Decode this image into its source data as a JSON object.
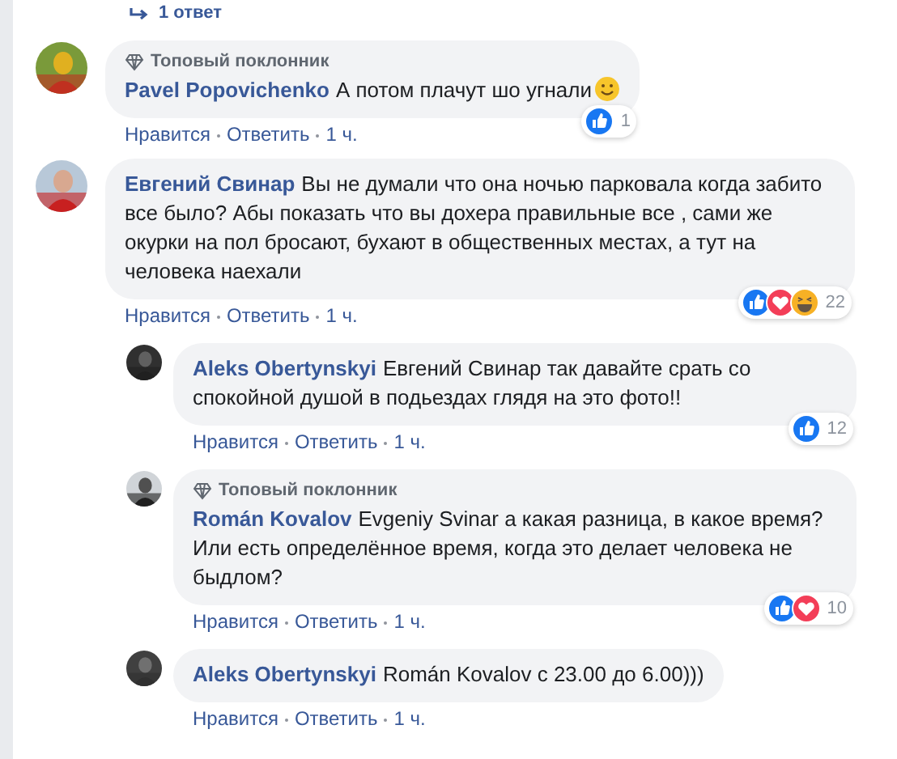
{
  "reply_link": {
    "text": "1 ответ"
  },
  "comments": [
    {
      "badge": "Топовый поклонник",
      "author": "Pavel Popovichenko",
      "text": "А потом плачут шо угнали",
      "emoji": {
        "kind": "smiley"
      },
      "reactions": [
        {
          "kind": "like"
        }
      ],
      "reaction_count": "1",
      "actions": [
        "Нравится",
        "Ответить",
        "1 ч."
      ]
    },
    {
      "author": "Евгений Свинар",
      "text": "Вы не думали что она ночью парковала когда забито все было? Абы показать что вы дохера правильные все , сами же окурки на пол бросают, бухают в общественных местах, а тут на человека наехали",
      "reactions": [
        {
          "kind": "like"
        },
        {
          "kind": "love"
        },
        {
          "kind": "haha"
        }
      ],
      "reaction_count": "22",
      "actions": [
        "Нравится",
        "Ответить",
        "1 ч."
      ],
      "replies": [
        {
          "author": "Aleks Obertynskyi",
          "text": "Евгений Свинар так давайте срать со спокойной душой в подьездах глядя на это фото!!",
          "reactions": [
            {
              "kind": "like"
            }
          ],
          "reaction_count": "12",
          "actions": [
            "Нравится",
            "Ответить",
            "1 ч."
          ]
        },
        {
          "badge": "Топовый поклонник",
          "author": "Román Kovalov",
          "text": "Evgeniy Svinar а какая разница, в какое время? Или есть определённое время, когда это делает человека не быдлом?",
          "reactions": [
            {
              "kind": "like"
            },
            {
              "kind": "love"
            }
          ],
          "reaction_count": "10",
          "actions": [
            "Нравится",
            "Ответить",
            "1 ч."
          ]
        },
        {
          "author": "Aleks Obertynskyi",
          "text": "Román Kovalov с 23.00 до 6.00)))",
          "actions": [
            "Нравится",
            "Ответить",
            "1 ч."
          ]
        }
      ]
    }
  ]
}
